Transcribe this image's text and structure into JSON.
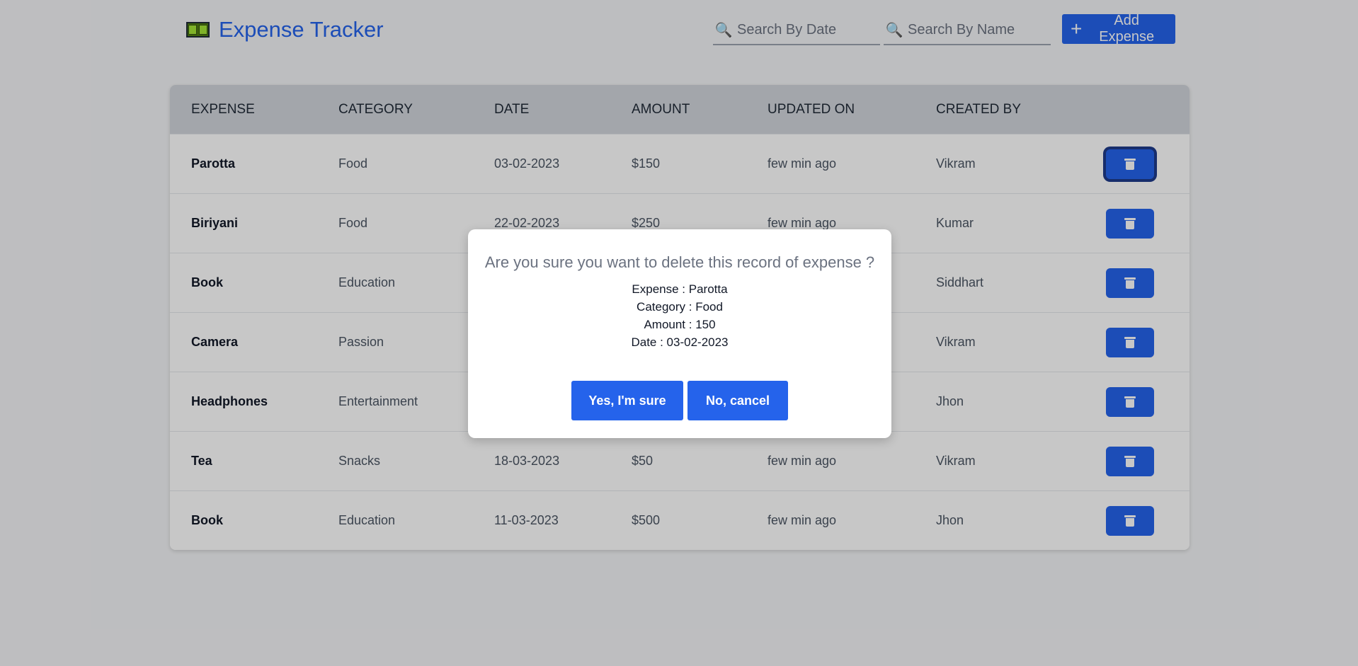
{
  "header": {
    "title": "Expense Tracker",
    "search_date_placeholder": "Search By Date",
    "search_name_placeholder": "Search By Name",
    "add_label": "Add Expense"
  },
  "table": {
    "columns": [
      "EXPENSE",
      "CATEGORY",
      "DATE",
      "AMOUNT",
      "UPDATED ON",
      "CREATED BY"
    ],
    "rows": [
      {
        "expense": "Parotta",
        "category": "Food",
        "date": "03-02-2023",
        "amount": "$150",
        "updated": "few min ago",
        "created_by": "Vikram"
      },
      {
        "expense": "Biriyani",
        "category": "Food",
        "date": "22-02-2023",
        "amount": "$250",
        "updated": "few min ago",
        "created_by": "Kumar"
      },
      {
        "expense": "Book",
        "category": "Education",
        "date": "",
        "amount": "",
        "updated": "",
        "created_by": "Siddhart"
      },
      {
        "expense": "Camera",
        "category": "Passion",
        "date": "",
        "amount": "",
        "updated": "",
        "created_by": "Vikram"
      },
      {
        "expense": "Headphones",
        "category": "Entertainment",
        "date": "",
        "amount": "",
        "updated": "",
        "created_by": "Jhon"
      },
      {
        "expense": "Tea",
        "category": "Snacks",
        "date": "18-03-2023",
        "amount": "$50",
        "updated": "few min ago",
        "created_by": "Vikram"
      },
      {
        "expense": "Book",
        "category": "Education",
        "date": "11-03-2023",
        "amount": "$500",
        "updated": "few min ago",
        "created_by": "Jhon"
      }
    ]
  },
  "modal": {
    "question": "Are you sure you want to delete this record of expense ?",
    "expense_line": "Expense : Parotta",
    "category_line": "Category : Food",
    "amount_line": "Amount : 150",
    "date_line": "Date : 03-02-2023",
    "confirm_label": "Yes, I'm sure",
    "cancel_label": "No, cancel"
  },
  "icons": {
    "brand": "money-icon",
    "search": "magnifier-icon",
    "add": "plus-icon",
    "delete": "trash-icon"
  },
  "colors": {
    "accent": "#2563eb",
    "header_bg": "#d1d5db",
    "page_bg": "#f3f4f6"
  }
}
